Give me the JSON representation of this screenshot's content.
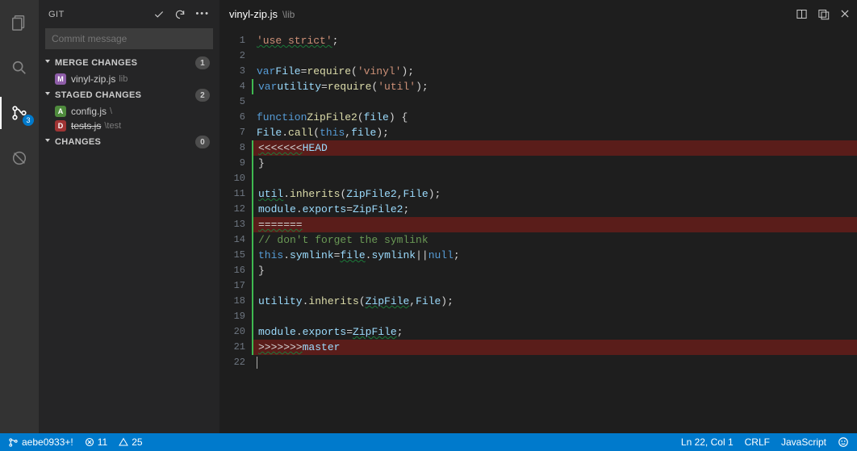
{
  "sidebar": {
    "title": "GIT",
    "commit_placeholder": "Commit message",
    "sections": {
      "merge": {
        "label": "MERGE CHANGES",
        "count": "1"
      },
      "staged": {
        "label": "STAGED CHANGES",
        "count": "2"
      },
      "changes": {
        "label": "CHANGES",
        "count": "0"
      }
    },
    "merge_files": [
      {
        "badge": "M",
        "name": "vinyl-zip.js",
        "sub": "lib"
      }
    ],
    "staged_files": [
      {
        "badge": "A",
        "name": "config.js",
        "sub": "\\"
      },
      {
        "badge": "D",
        "name": "tests.js",
        "sub": "\\test",
        "strike": true
      }
    ]
  },
  "scm_badge": "3",
  "tab": {
    "file": "vinyl-zip.js",
    "sub": "\\lib"
  },
  "code": [
    {
      "n": 1,
      "bg": "",
      "html": "<span class='ck-str wavy'>'use strict'</span><span class='ck-p'>;</span>"
    },
    {
      "n": 2,
      "bg": "",
      "html": ""
    },
    {
      "n": 3,
      "bg": "",
      "html": "<span class='ck-kw'>var</span> <span class='ck-id'>File</span> <span class='ck-p'>=</span> <span class='ck-fn'>require</span><span class='ck-p'>(</span><span class='ck-str'>'vinyl'</span><span class='ck-p'>);</span>"
    },
    {
      "n": 4,
      "bg": "added-bar",
      "html": "<span class='ck-kw'>var</span> <span class='ck-id'>utility</span> <span class='ck-p'>=</span> <span class='ck-fn'>require</span><span class='ck-p'>(</span><span class='ck-str'>'util'</span><span class='ck-p'>);</span>"
    },
    {
      "n": 5,
      "bg": "",
      "html": ""
    },
    {
      "n": 6,
      "bg": "",
      "html": "<span class='ck-kw'>function</span> <span class='ck-fn'>ZipFile2</span><span class='ck-p'>(</span><span class='ck-id'>file</span><span class='ck-p'>) {</span>"
    },
    {
      "n": 7,
      "bg": "",
      "html": "    <span class='ck-id'>File</span><span class='ck-p'>.</span><span class='ck-fn'>call</span><span class='ck-p'>(</span><span class='ck-kw'>this</span><span class='ck-p'>,</span> <span class='ck-id'>file</span><span class='ck-p'>);</span>"
    },
    {
      "n": 8,
      "bg": "conflict added-bar",
      "html": "<span class='ck-p wavy'>&lt;&lt;&lt;&lt;&lt;&lt;&lt;</span> <span class='ck-id'>HEAD</span>"
    },
    {
      "n": 9,
      "bg": "added-bar",
      "html": "<span class='ck-p'>}</span>"
    },
    {
      "n": 10,
      "bg": "added-bar",
      "html": ""
    },
    {
      "n": 11,
      "bg": "added-bar",
      "html": "<span class='ck-id wavy'>util</span><span class='ck-p'>.</span><span class='ck-fn'>inherits</span><span class='ck-p'>(</span><span class='ck-id'>ZipFile2</span><span class='ck-p'>,</span> <span class='ck-id'>File</span><span class='ck-p'>);</span>"
    },
    {
      "n": 12,
      "bg": "added-bar",
      "html": "<span class='ck-id'>module</span><span class='ck-p'>.</span><span class='ck-id'>exports</span> <span class='ck-p'>=</span> <span class='ck-id'>ZipFile2</span><span class='ck-p'>;</span>"
    },
    {
      "n": 13,
      "bg": "conflict added-bar",
      "html": "<span class='ck-p wavy'>=======</span>"
    },
    {
      "n": 14,
      "bg": "added-bar",
      "html": "    <span class='ck-com'>// don't forget the symlink</span>"
    },
    {
      "n": 15,
      "bg": "added-bar",
      "html": "    <span class='ck-kw'>this</span><span class='ck-p'>.</span><span class='ck-id'>symlink</span> <span class='ck-p'>=</span> <span class='ck-id wavy'>file</span><span class='ck-p'>.</span><span class='ck-id'>symlink</span> <span class='ck-p'>||</span> <span class='ck-kw'>null</span><span class='ck-p'>;</span>"
    },
    {
      "n": 16,
      "bg": "added-bar",
      "html": "<span class='ck-p'>}</span>"
    },
    {
      "n": 17,
      "bg": "added-bar",
      "html": ""
    },
    {
      "n": 18,
      "bg": "added-bar",
      "html": "<span class='ck-id'>utility</span><span class='ck-p'>.</span><span class='ck-fn'>inherits</span><span class='ck-p'>(</span><span class='ck-id wavy'>ZipFile</span><span class='ck-p'>,</span> <span class='ck-id'>File</span><span class='ck-p'>);</span>"
    },
    {
      "n": 19,
      "bg": "added-bar",
      "html": ""
    },
    {
      "n": 20,
      "bg": "added-bar",
      "html": "<span class='ck-id'>module</span><span class='ck-p'>.</span><span class='ck-id'>exports</span> <span class='ck-p'>=</span> <span class='ck-id wavy'>ZipFile</span><span class='ck-p'>;</span>"
    },
    {
      "n": 21,
      "bg": "conflict added-bar",
      "html": "<span class='ck-p wavy'>&gt;&gt;&gt;&gt;&gt;&gt;&gt;</span> <span class='ck-id'>master</span>"
    },
    {
      "n": 22,
      "bg": "",
      "html": "<span class='cursor-bar'></span>"
    }
  ],
  "status": {
    "branch": "aebe0933+!",
    "errors": "11",
    "warnings": "25",
    "lncol": "Ln 22, Col 1",
    "eol": "CRLF",
    "lang": "JavaScript"
  }
}
